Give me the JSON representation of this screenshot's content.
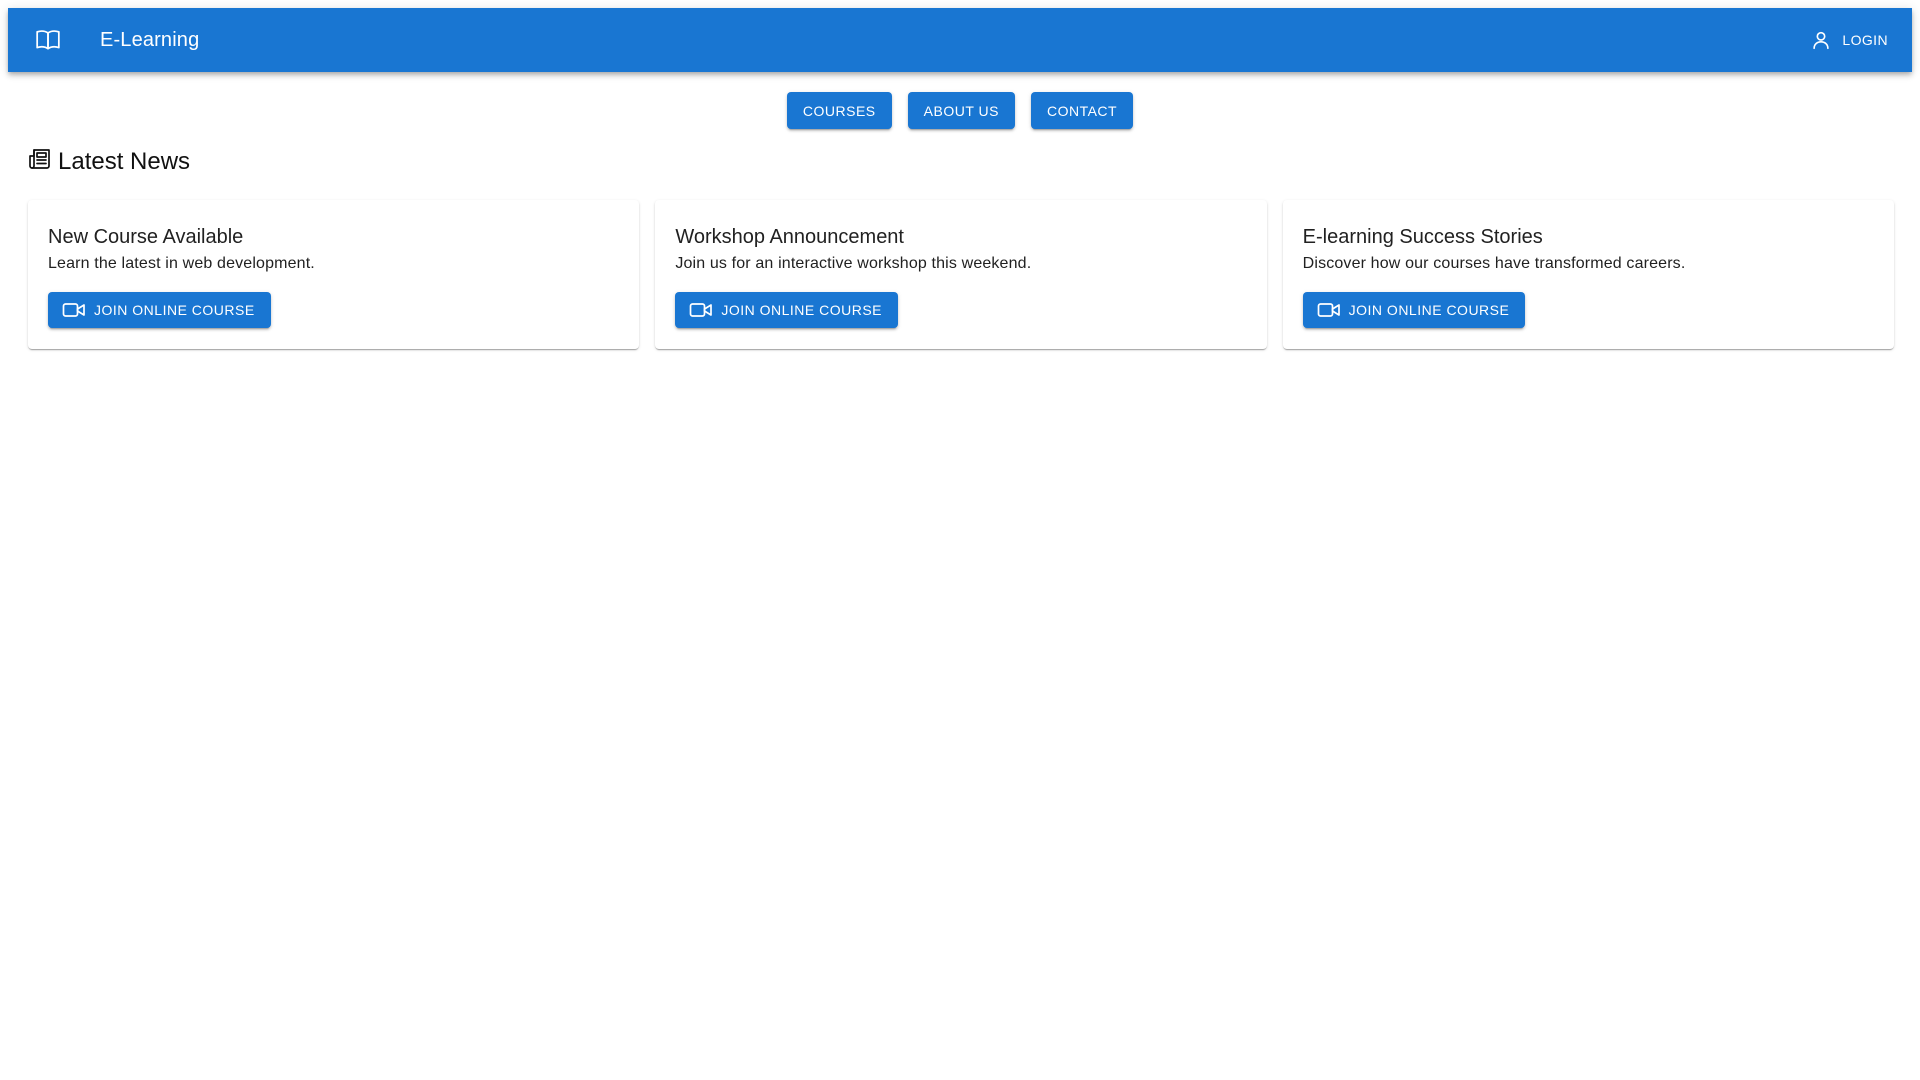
{
  "appbar": {
    "icon": "book-open-icon",
    "title": "E-Learning",
    "login_icon": "user-icon",
    "login_label": "LOGIN",
    "color": "#1976d2"
  },
  "nav": {
    "items": [
      {
        "label": "COURSES"
      },
      {
        "label": "ABOUT US"
      },
      {
        "label": "CONTACT"
      }
    ]
  },
  "news": {
    "icon": "newspaper-icon",
    "title": "Latest News",
    "cards": [
      {
        "title": "New Course Available",
        "body": "Learn the latest in web development.",
        "button_icon": "video-icon",
        "button_label": "JOIN ONLINE COURSE"
      },
      {
        "title": "Workshop Announcement",
        "body": "Join us for an interactive workshop this weekend.",
        "button_icon": "video-icon",
        "button_label": "JOIN ONLINE COURSE"
      },
      {
        "title": "E-learning Success Stories",
        "body": "Discover how our courses have transformed careers.",
        "button_icon": "video-icon",
        "button_label": "JOIN ONLINE COURSE"
      }
    ]
  }
}
